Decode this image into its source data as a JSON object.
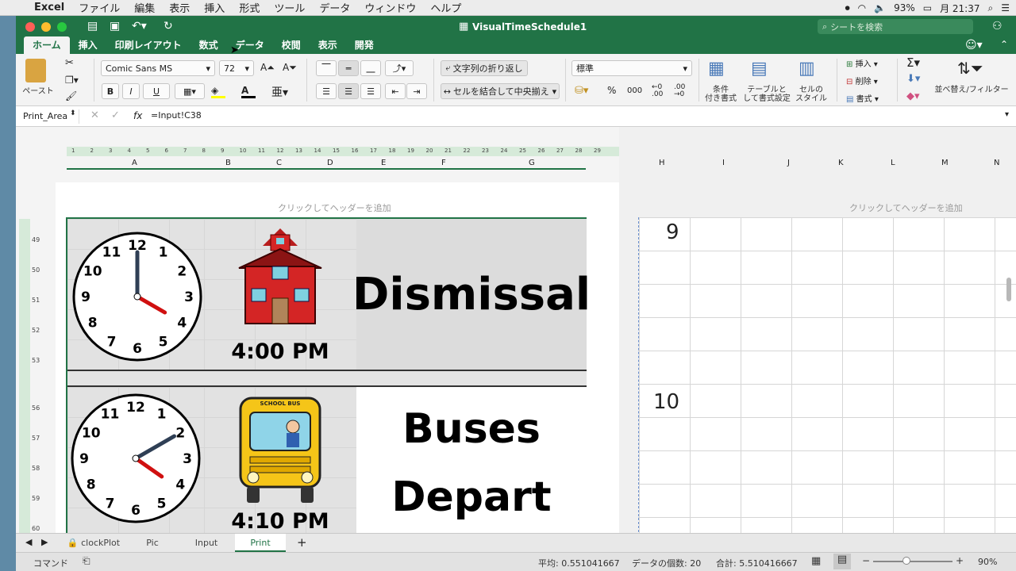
{
  "menubar": {
    "app": "Excel",
    "items": [
      "ファイル",
      "編集",
      "表示",
      "挿入",
      "形式",
      "ツール",
      "データ",
      "ウィンドウ",
      "ヘルプ"
    ],
    "battery": "93%",
    "clock": "月 21:37"
  },
  "window": {
    "title": "VisualTimeSchedule1",
    "search_placeholder": "シートを検索"
  },
  "ribbon_tabs": [
    "ホーム",
    "挿入",
    "印刷レイアウト",
    "数式",
    "データ",
    "校閲",
    "表示",
    "開発"
  ],
  "ribbon": {
    "paste": "ペースト",
    "font_name": "Comic Sans MS",
    "font_size": "72",
    "wrap_text": "文字列の折り返し",
    "merge_center": "セルを結合して中央揃え",
    "number_format": "標準",
    "conditional_format": [
      "条件",
      "付き書式"
    ],
    "table_format": [
      "テーブルと",
      "して書式設定"
    ],
    "cell_styles": [
      "セルの",
      "スタイル"
    ],
    "insert": "挿入",
    "delete": "削除",
    "format": "書式",
    "sort_filter": "並べ替え/フィルター",
    "percent": "%",
    "thousands": "000",
    "bold": "B",
    "italic": "I",
    "underline": "U",
    "font_color": "A"
  },
  "formula_bar": {
    "name_box": "Print_Area",
    "fx": "fx",
    "formula": "=Input!C38"
  },
  "columns_left": [
    "A",
    "B",
    "C",
    "D",
    "E",
    "F",
    "G"
  ],
  "columns_right": [
    "H",
    "I",
    "J",
    "K",
    "L",
    "M",
    "N"
  ],
  "ruler_numbers": [
    "1",
    "2",
    "3",
    "4",
    "5",
    "6",
    "7",
    "8",
    "9",
    "10",
    "11",
    "12",
    "13",
    "14",
    "15",
    "16",
    "17",
    "18",
    "19",
    "20",
    "21",
    "22",
    "23",
    "24",
    "25",
    "26",
    "27",
    "28",
    "29"
  ],
  "rows": [
    "49",
    "50",
    "51",
    "52",
    "53",
    "56",
    "57",
    "58",
    "59",
    "60"
  ],
  "header_placeholder": "クリックしてヘッダーを追加",
  "schedule": [
    {
      "time": "4:00 PM",
      "activity": [
        "Dismissal"
      ]
    },
    {
      "time": "4:10 PM",
      "activity": [
        "Buses",
        "Depart"
      ]
    }
  ],
  "clock_numbers": [
    "12",
    "1",
    "2",
    "3",
    "4",
    "5",
    "6",
    "7",
    "8",
    "9",
    "10",
    "11"
  ],
  "bus_label": "SCHOOL BUS",
  "right_numbers": [
    "9",
    "10"
  ],
  "sheet_tabs": [
    "clockPlot",
    "Pic",
    "Input",
    "Print"
  ],
  "active_sheet": "Print",
  "statusbar": {
    "mode": "コマンド",
    "average": "平均: 0.551041667",
    "count": "データの個数: 20",
    "sum": "合計: 5.510416667",
    "zoom": "90%"
  },
  "colors": {
    "excel_green": "#217346",
    "schoolhouse_red": "#d42525",
    "bus_yellow": "#f5c518"
  }
}
